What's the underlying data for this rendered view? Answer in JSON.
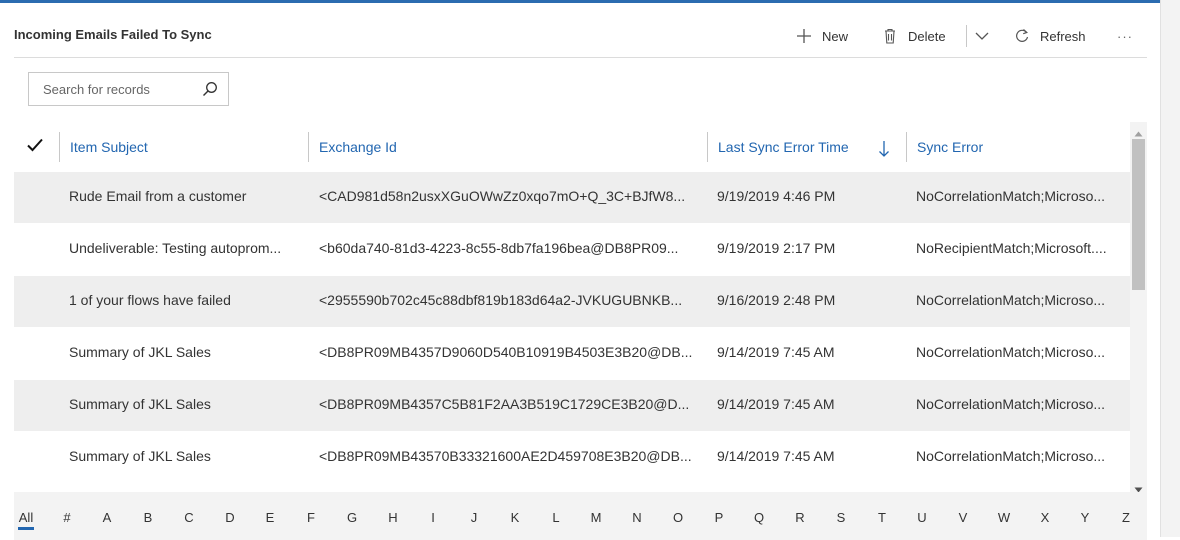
{
  "header": {
    "title": "Incoming Emails Failed To Sync",
    "commands": {
      "new_label": "New",
      "delete_label": "Delete",
      "refresh_label": "Refresh",
      "more_label": "···"
    }
  },
  "search": {
    "placeholder": "Search for records",
    "value": ""
  },
  "grid": {
    "columns": [
      "Item Subject",
      "Exchange Id",
      "Last Sync Error Time",
      "Sync Error"
    ],
    "sorted_column": "Last Sync Error Time",
    "sort_direction": "descending",
    "rows": [
      {
        "subject": "Rude Email from a customer",
        "exchange_id": "<CAD981d58n2usxXGuOWwZz0xqo7mO+Q_3C+BJfW8...",
        "time": "9/19/2019 4:46 PM",
        "error": "NoCorrelationMatch;Microso..."
      },
      {
        "subject": "Undeliverable: Testing autoprom...",
        "exchange_id": "<b60da740-81d3-4223-8c55-8db7fa196bea@DB8PR09...",
        "time": "9/19/2019 2:17 PM",
        "error": "NoRecipientMatch;Microsoft...."
      },
      {
        "subject": "1 of your flows have failed",
        "exchange_id": "<2955590b702c45c88dbf819b183d64a2-JVKUGUBNKB...",
        "time": "9/16/2019 2:48 PM",
        "error": "NoCorrelationMatch;Microso..."
      },
      {
        "subject": "Summary of JKL Sales",
        "exchange_id": "<DB8PR09MB4357D9060D540B10919B4503E3B20@DB...",
        "time": "9/14/2019 7:45 AM",
        "error": "NoCorrelationMatch;Microso..."
      },
      {
        "subject": "Summary of JKL Sales",
        "exchange_id": "<DB8PR09MB4357C5B81F2AA3B519C1729CE3B20@D...",
        "time": "9/14/2019 7:45 AM",
        "error": "NoCorrelationMatch;Microso..."
      },
      {
        "subject": "Summary of JKL Sales",
        "exchange_id": "<DB8PR09MB43570B33321600AE2D459708E3B20@DB...",
        "time": "9/14/2019 7:45 AM",
        "error": "NoCorrelationMatch;Microso..."
      }
    ]
  },
  "alphabet": {
    "active": "All",
    "letters": [
      "All",
      "#",
      "A",
      "B",
      "C",
      "D",
      "E",
      "F",
      "G",
      "H",
      "I",
      "J",
      "K",
      "L",
      "M",
      "N",
      "O",
      "P",
      "Q",
      "R",
      "S",
      "T",
      "U",
      "V",
      "W",
      "X",
      "Y",
      "Z"
    ]
  },
  "icons": {
    "new": "plus-icon",
    "delete": "trash-icon",
    "split": "chevron-down-icon",
    "refresh": "refresh-icon",
    "search": "search-icon",
    "select_all": "checkmark-icon",
    "sort": "arrow-down-icon"
  },
  "colors": {
    "accent": "#2266b0",
    "top_bar": "#2b6cb0",
    "row_shade": "#eeeeee"
  }
}
